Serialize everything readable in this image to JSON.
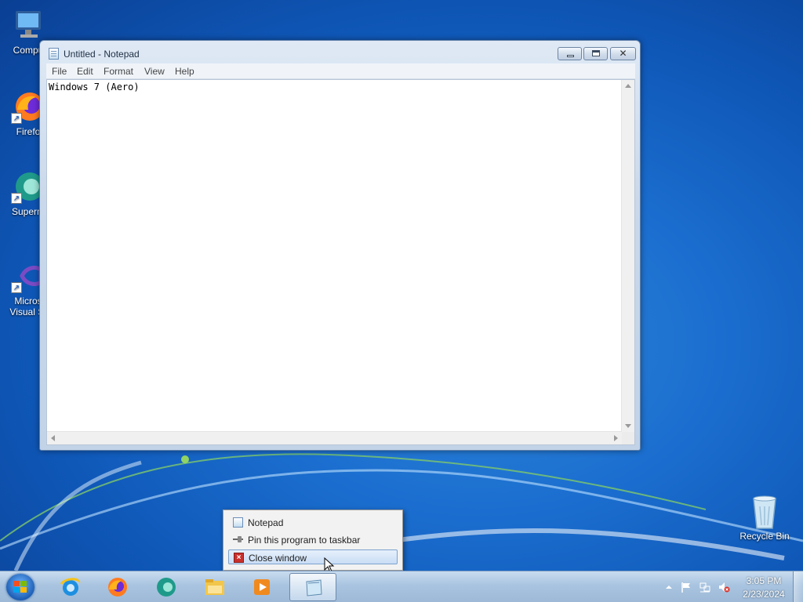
{
  "desktop": {
    "icons": [
      {
        "label": "Compu",
        "icon": "computer-icon"
      },
      {
        "label": "Firefo",
        "icon": "firefox-icon"
      },
      {
        "label": "Superm",
        "icon": "supermium-icon"
      },
      {
        "label": "Micros",
        "label2": "Visual St",
        "icon": "visual-studio-icon"
      },
      {
        "label": "Recycle Bin",
        "icon": "recycle-bin-icon"
      }
    ]
  },
  "notepad": {
    "title": "Untitled - Notepad",
    "menu": [
      "File",
      "Edit",
      "Format",
      "View",
      "Help"
    ],
    "content": "Windows 7 (Aero)"
  },
  "jumplist": {
    "items": [
      {
        "label": "Notepad",
        "icon": "notepad-icon"
      },
      {
        "label": "Pin this program to taskbar",
        "icon": "pin-icon"
      },
      {
        "label": "Close window",
        "icon": "close-icon",
        "highlighted": true
      }
    ]
  },
  "taskbar": {
    "apps": [
      "internet-explorer-icon",
      "firefox-icon",
      "supermium-icon",
      "file-explorer-icon",
      "media-player-icon",
      "notepad-icon"
    ],
    "clock": {
      "time": "3:05 PM",
      "date": "2/23/2024"
    }
  },
  "colors": {
    "desktop_blue": "#1b6ecf",
    "taskbar": "#a9c4e0",
    "highlight": "#c9ddf5"
  }
}
